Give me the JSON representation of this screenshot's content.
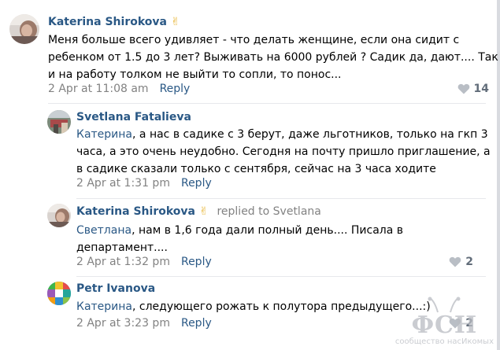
{
  "comments": [
    {
      "author": "Katerina Shirokova",
      "emoji": "✌",
      "text": "Меня больше всего удивляет - что делать женщине, если она сидит с\nребенком от 1.5 до 3 лет? Выживать на 6000 рублей ? Садик да, дают.... Так\nи на работу толком не выйти то сопли, то понос...",
      "date": "2 Apr at 11:08 am",
      "reply_label": "Reply",
      "likes": "14"
    },
    {
      "author": "Svetlana Fatalieva",
      "mention": "Катерина",
      "text": ", а нас в садике с 3 берут, даже льготников, только на гкп 3\nчаса, а это очень неудобно. Сегодня на почту пришло приглашение, а\nв садике сказали только с сентября, сейчас на 3 часа ходите",
      "date": "2 Apr at 1:31 pm",
      "reply_label": "Reply"
    },
    {
      "author": "Katerina Shirokova",
      "emoji": "✌",
      "replied_to_prefix": "replied to",
      "replied_to_name": "Svetlana",
      "mention": "Светлана",
      "text": ", нам в 1,6 года дали полный день.... Писала в\nдепартамент....",
      "date": "2 Apr at 1:32 pm",
      "reply_label": "Reply",
      "likes": "2"
    },
    {
      "author": "Petr Ivanova",
      "mention": "Катерина",
      "text": ", следующего рожать к полутора предыдущего...:)",
      "date": "2 Apr at 3:23 pm",
      "reply_label": "Reply",
      "likes": "2"
    }
  ],
  "watermark": {
    "logo": "ФСН",
    "caption": "сообщество насИкомых"
  },
  "colors": {
    "link": "#2a5885",
    "meta": "#828282",
    "likes": "#626d7a",
    "emoji": "#e8b73a"
  }
}
